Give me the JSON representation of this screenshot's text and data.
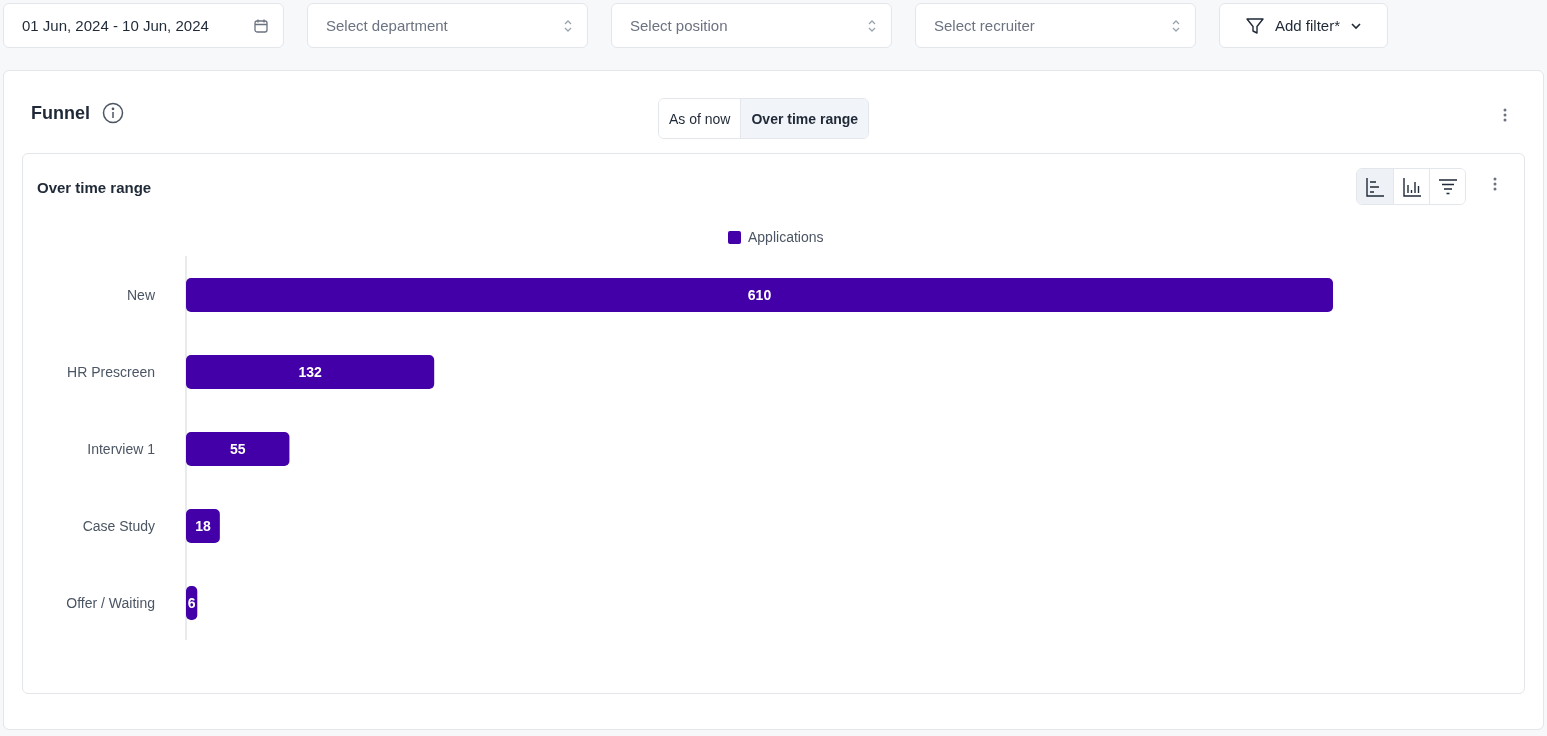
{
  "filters": {
    "date_range": {
      "value": "01 Jun, 2024 - 10 Jun, 2024"
    },
    "selects": [
      {
        "placeholder": "Select department"
      },
      {
        "placeholder": "Select position"
      },
      {
        "placeholder": "Select recruiter"
      }
    ],
    "add_filter": {
      "label": "Add filter*"
    }
  },
  "funnel": {
    "title": "Funnel",
    "modes": [
      {
        "label": "As of now",
        "selected": false
      },
      {
        "label": "Over time range",
        "selected": true
      }
    ],
    "panel": {
      "title": "Over time range",
      "views": [
        {
          "kind": "horizontal-bar",
          "selected": true
        },
        {
          "kind": "vertical-bar",
          "selected": false
        },
        {
          "kind": "funnel",
          "selected": false
        }
      ],
      "chart_data": {
        "type": "bar",
        "orientation": "horizontal",
        "categories": [
          "New",
          "HR Prescreen",
          "Interview 1",
          "Case Study",
          "Offer / Waiting"
        ],
        "series": [
          {
            "name": "Applications",
            "color": "#4300a8",
            "values": [
              610,
              132,
              55,
              18,
              6
            ]
          }
        ],
        "data_labels": true
      }
    }
  }
}
